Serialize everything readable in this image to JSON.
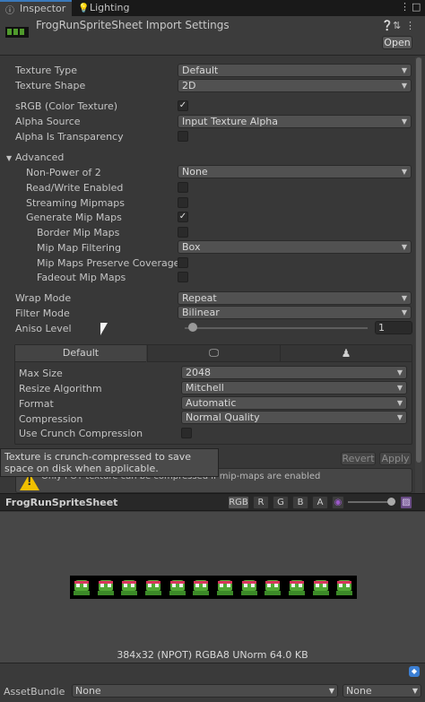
{
  "tabs": [
    {
      "label": "Inspector",
      "icon": "info-icon"
    },
    {
      "label": "Lighting",
      "icon": "lightbulb-icon"
    }
  ],
  "header": {
    "title": "FrogRunSpriteSheet Import Settings",
    "open_label": "Open",
    "icons": [
      "help-icon",
      "settings-sliders-icon",
      "more-icon"
    ]
  },
  "settings": {
    "texture_type": {
      "label": "Texture Type",
      "value": "Default"
    },
    "texture_shape": {
      "label": "Texture Shape",
      "value": "2D"
    },
    "srgb": {
      "label": "sRGB (Color Texture)",
      "checked": true
    },
    "alpha_source": {
      "label": "Alpha Source",
      "value": "Input Texture Alpha"
    },
    "alpha_transparency": {
      "label": "Alpha Is Transparency",
      "checked": false
    },
    "advanced": {
      "label": "Advanced"
    },
    "npot": {
      "label": "Non-Power of 2",
      "value": "None"
    },
    "read_write": {
      "label": "Read/Write Enabled",
      "checked": false
    },
    "streaming": {
      "label": "Streaming Mipmaps",
      "checked": false
    },
    "gen_mips": {
      "label": "Generate Mip Maps",
      "checked": true
    },
    "border_mips": {
      "label": "Border Mip Maps",
      "checked": false
    },
    "mip_filter": {
      "label": "Mip Map Filtering",
      "value": "Box"
    },
    "preserve_coverage": {
      "label": "Mip Maps Preserve Coverage",
      "checked": false
    },
    "fadeout": {
      "label": "Fadeout Mip Maps",
      "checked": false
    },
    "wrap_mode": {
      "label": "Wrap Mode",
      "value": "Repeat"
    },
    "filter_mode": {
      "label": "Filter Mode",
      "value": "Bilinear"
    },
    "aniso": {
      "label": "Aniso Level",
      "value": "1",
      "fraction": 0.0
    }
  },
  "platform": {
    "tabs": [
      "Default"
    ],
    "tab_icons": [
      "monitor-icon",
      "android-icon"
    ],
    "max_size": {
      "label": "Max Size",
      "value": "2048"
    },
    "resize": {
      "label": "Resize Algorithm",
      "value": "Mitchell"
    },
    "format": {
      "label": "Format",
      "value": "Automatic"
    },
    "compression": {
      "label": "Compression",
      "value": "Normal Quality"
    },
    "crunch": {
      "label": "Use Crunch Compression",
      "checked": false
    }
  },
  "tooltip": "Texture is crunch-compressed to save space on disk when applicable.",
  "buttons": {
    "revert": "Revert",
    "apply": "Apply"
  },
  "help": {
    "text": "Only POT texture can be compressed if mip-maps are enabled"
  },
  "preview": {
    "title": "FrogRunSpriteSheet",
    "channels": [
      "RGB",
      "R",
      "G",
      "B",
      "A"
    ],
    "mip_level": 1.0,
    "frame_count": 12,
    "info": "384x32 (NPOT)  RGBA8 UNorm  64.0 KB"
  },
  "asset_bundle": {
    "label": "AssetBundle",
    "name": "None",
    "variant": "None"
  },
  "colors": {
    "accent": "#3a79bb",
    "frog_green": "#53a836",
    "headband": "#d8355c",
    "warning": "#f0c000"
  }
}
